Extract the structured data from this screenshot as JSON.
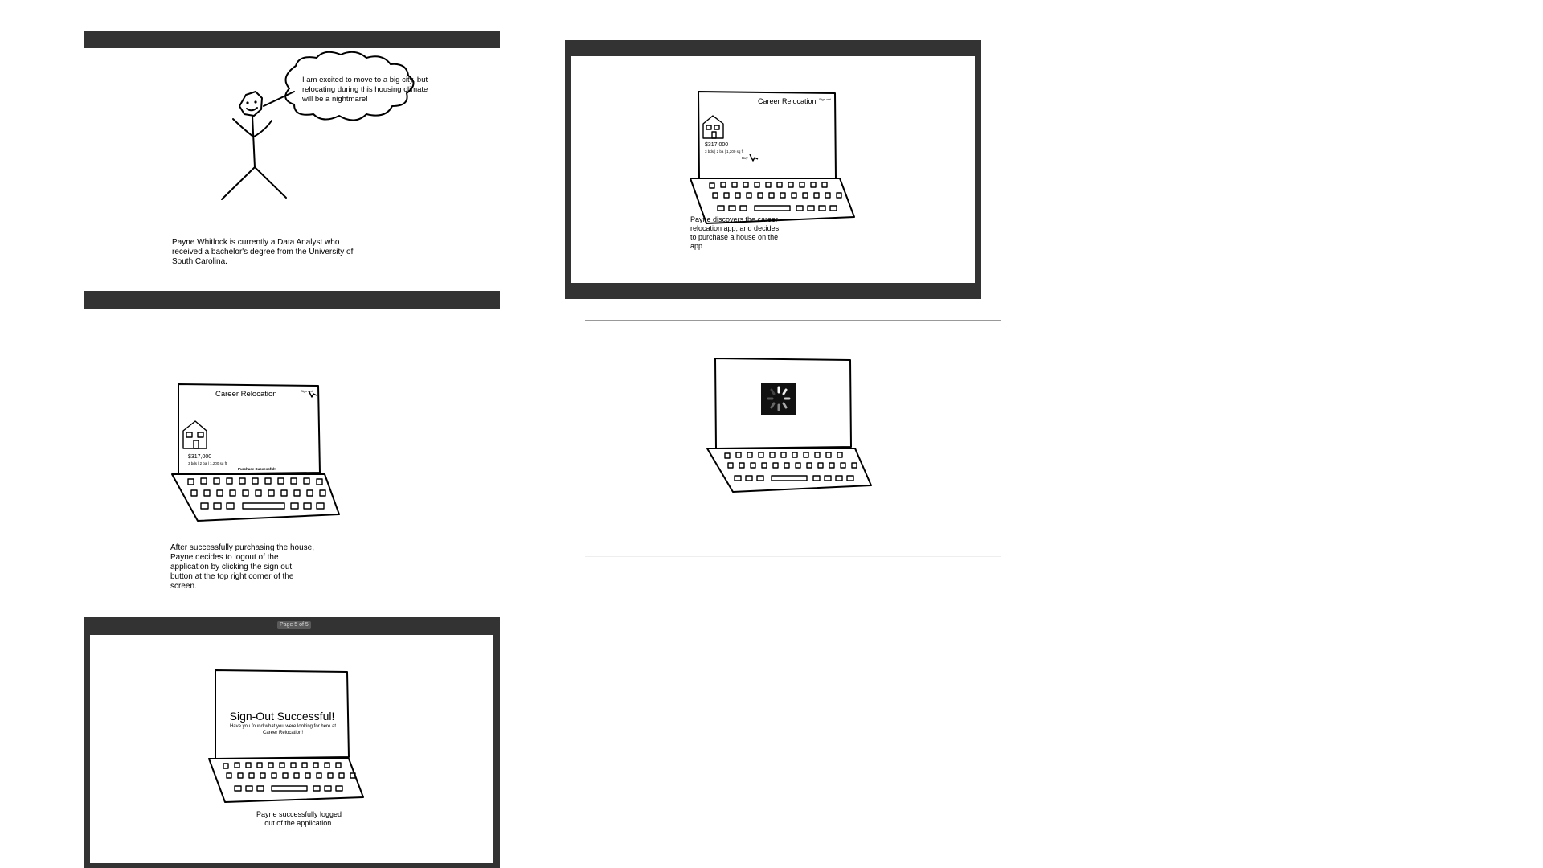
{
  "panels": [
    {
      "speech": "I am excited to move to a big city, but relocating during this housing climate will be a nightmare!",
      "caption": "Payne Whitlock is currently a Data Analyst who received a bachelor's degree from the University of South Carolina."
    },
    {
      "screen_title": "Career Relocation",
      "top_right_label": "Sign out",
      "price": "$317,000",
      "details": "3 bds | 2 ba | 1,200 sq ft",
      "button": "Buy",
      "caption": "Payne discovers the career relocation app, and decides to purchase a house on the app."
    },
    {
      "screen_title": "Career Relocation",
      "top_right_label": "Sign out",
      "price": "$317,000",
      "details": "3 bds | 2 ba | 1,200 sq ft",
      "status": "Purchase Successful!",
      "caption": "After successfully purchasing the house, Payne decides to logout of the application by clicking the sign out button at the top right corner of the screen."
    },
    {
      "loading_icon": "spinner-icon"
    },
    {
      "page_indicator": "Page 5 of 5",
      "heading": "Sign-Out Successful!",
      "subtext": "Have you found what you were looking for here at Career Relocation!",
      "caption": "Payne successfully logged out of the application."
    }
  ],
  "colors": {
    "frame": "#333333",
    "page": "#ffffff",
    "divider": "#999999"
  }
}
